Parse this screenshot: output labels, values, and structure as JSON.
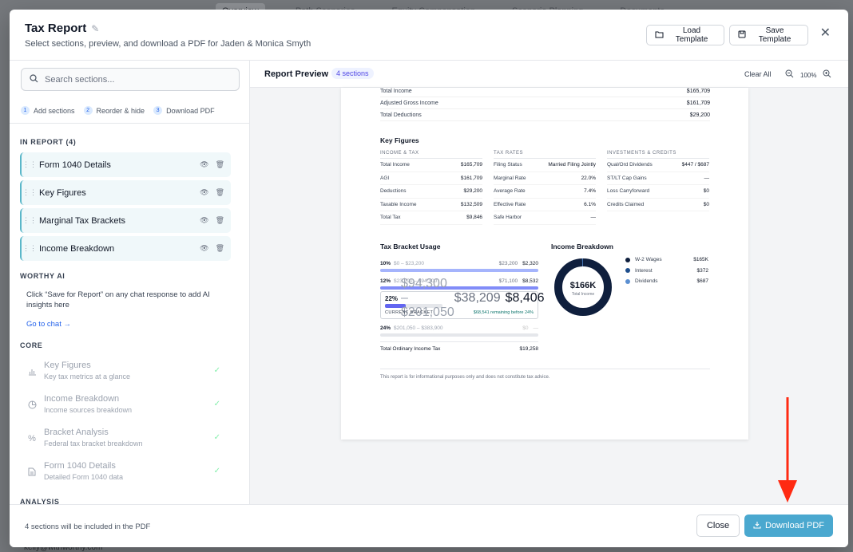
{
  "background": {
    "tabs": [
      "Overview",
      "Path Scenarios",
      "Equity Compensation",
      "Scenario Planning",
      "Documents"
    ],
    "footer_email": "kelly@withworthy.com"
  },
  "modal": {
    "title": "Tax Report",
    "subtitle": "Select sections, preview, and download a PDF for Jaden & Monica Smyth",
    "load_template": "Load Template",
    "save_template": "Save Template"
  },
  "sidebar": {
    "search_placeholder": "Search sections...",
    "steps": [
      {
        "num": "1",
        "label": "Add sections"
      },
      {
        "num": "2",
        "label": "Reorder & hide"
      },
      {
        "num": "3",
        "label": "Download PDF"
      }
    ],
    "in_report_label": "IN REPORT (4)",
    "in_report": [
      {
        "label": "Form 1040 Details"
      },
      {
        "label": "Key Figures"
      },
      {
        "label": "Marginal Tax Brackets"
      },
      {
        "label": "Income Breakdown"
      }
    ],
    "worthy_ai_label": "WORTHY AI",
    "worthy_ai_text": "Click “Save for Report” on any chat response to add AI insights here",
    "go_to_chat": "Go to chat →",
    "core_label": "CORE",
    "core": [
      {
        "title": "Key Figures",
        "sub": "Key tax metrics at a glance",
        "icon": "bar-chart-icon"
      },
      {
        "title": "Income Breakdown",
        "sub": "Income sources breakdown",
        "icon": "pie-chart-icon"
      },
      {
        "title": "Bracket Analysis",
        "sub": "Federal tax bracket breakdown",
        "icon": "percent-icon"
      },
      {
        "title": "Form 1040 Details",
        "sub": "Detailed Form 1040 data",
        "icon": "document-icon"
      }
    ],
    "analysis_label": "ANALYSIS"
  },
  "preview": {
    "title": "Report Preview",
    "badge": "4 sections",
    "clear_all": "Clear All",
    "zoom": "100%",
    "summary_rows": [
      {
        "label": "Total Income",
        "value": "$165,709"
      },
      {
        "label": "Adjusted Gross Income",
        "value": "$161,709"
      },
      {
        "label": "Total Deductions",
        "value": "$29,200"
      }
    ],
    "key_figures_title": "Key Figures",
    "key_columns": [
      {
        "header": "INCOME & TAX",
        "rows": [
          {
            "label": "Total Income",
            "value": "$165,709"
          },
          {
            "label": "AGI",
            "value": "$161,709"
          },
          {
            "label": "Deductions",
            "value": "$29,200"
          },
          {
            "label": "Taxable Income",
            "value": "$132,509"
          },
          {
            "label": "Total Tax",
            "value": "$9,846"
          }
        ]
      },
      {
        "header": "TAX RATES",
        "rows": [
          {
            "label": "Filing Status",
            "value": "Married Filing Jointly"
          },
          {
            "label": "Marginal Rate",
            "value": "22.0%"
          },
          {
            "label": "Average Rate",
            "value": "7.4%"
          },
          {
            "label": "Effective Rate",
            "value": "6.1%"
          },
          {
            "label": "Safe Harbor",
            "value": "—"
          }
        ]
      },
      {
        "header": "INVESTMENTS & CREDITS",
        "rows": [
          {
            "label": "Qual/Ord Dividends",
            "value": "$447 / $687"
          },
          {
            "label": "ST/LT Cap Gains",
            "value": "—"
          },
          {
            "label": "Loss Carryforward",
            "value": "$0"
          },
          {
            "label": "Credits Claimed",
            "value": "$0"
          }
        ]
      }
    ],
    "bracket_title": "Tax Bracket Usage",
    "brackets": [
      {
        "rate": "10%",
        "range": "$0 – $23,200",
        "amount": "$23,200",
        "tax": "$2,320",
        "fill": 1.0,
        "color": "#a5b4fc"
      },
      {
        "rate": "12%",
        "range": "$23,200 – $94,300",
        "amount": "$71,100",
        "tax": "$8,532",
        "fill": 1.0,
        "color": "#818cf8"
      },
      {
        "rate": "22%",
        "range": "$94,300 – $201,050",
        "amount": "$38,209",
        "tax": "$8,406",
        "fill": 0.36,
        "color": "#6366f1"
      },
      {
        "rate": "24%",
        "range": "$201,050 – $383,900",
        "amount": "$0",
        "tax": "—",
        "fill": 0,
        "color": "#c7d2fe"
      }
    ],
    "current_bracket_label": "CURRENT BRACKET",
    "current_bracket_note": "$68,541 remaining before 24%",
    "total_ordinary_label": "Total Ordinary Income Tax",
    "total_ordinary_value": "$19,258",
    "income_title": "Income Breakdown",
    "donut_value": "$166K",
    "donut_sub": "Total Income",
    "income_legend": [
      {
        "label": "W-2 Wages",
        "value": "$165K",
        "color": "#0f1f3d",
        "share": 0.9932
      },
      {
        "label": "Interest",
        "value": "$372",
        "color": "#1e4e8c",
        "share": 0.0022
      },
      {
        "label": "Dividends",
        "value": "$687",
        "color": "#5b8fd1",
        "share": 0.0046
      }
    ],
    "disclaimer": "This report is for informational purposes only and does not constitute tax advice."
  },
  "footer": {
    "info": "4 sections will be included in the PDF",
    "close": "Close",
    "download": "Download PDF"
  }
}
